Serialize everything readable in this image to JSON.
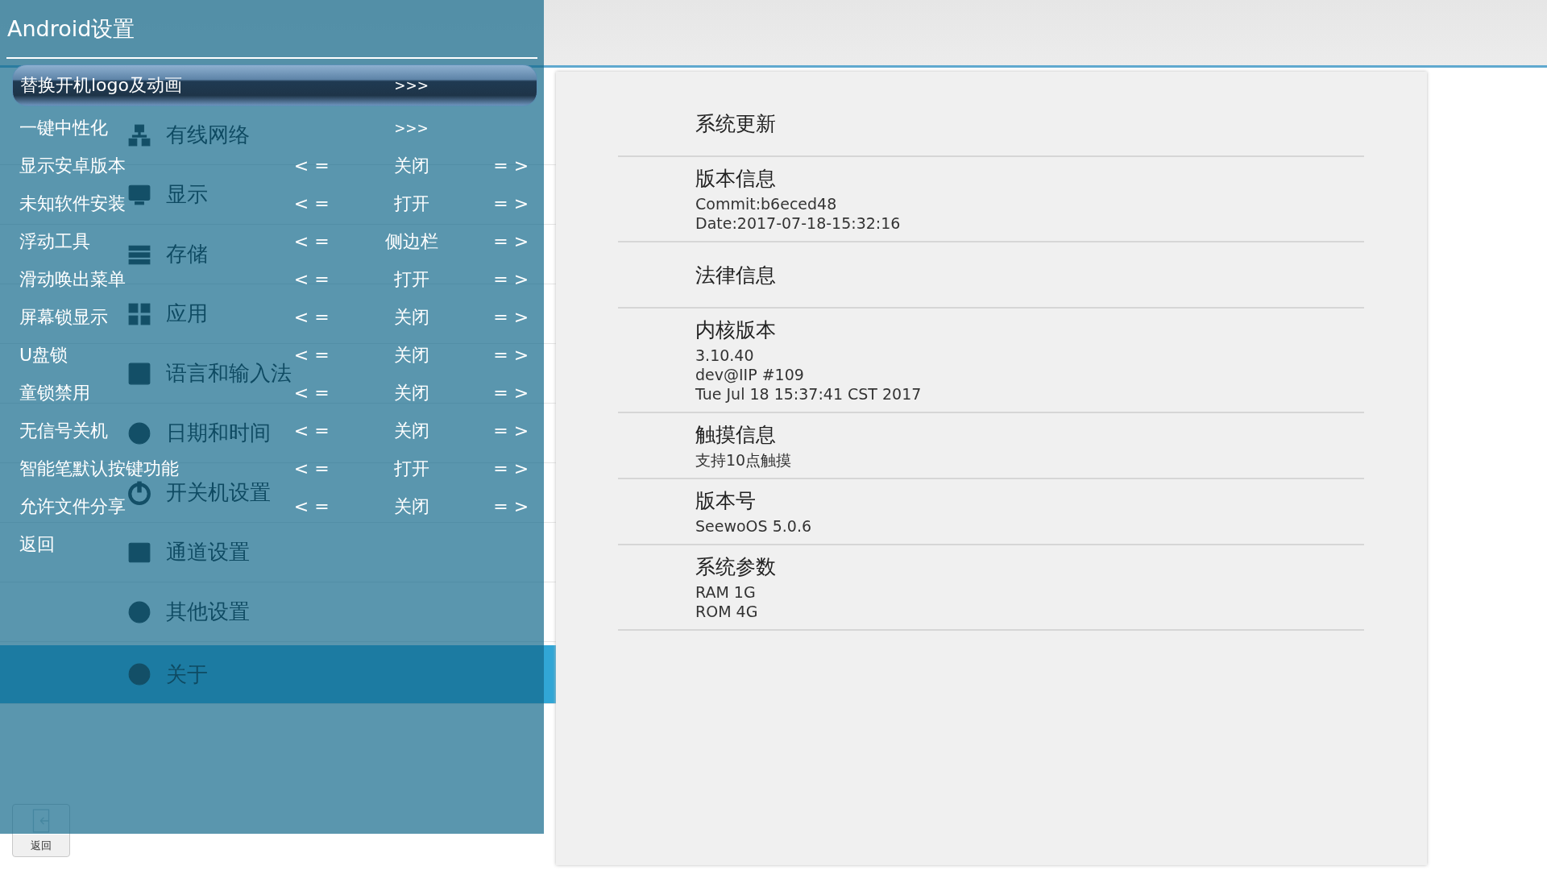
{
  "sidebar": {
    "items": [
      {
        "label": "有线网络",
        "selected": false
      },
      {
        "label": "显示",
        "selected": false
      },
      {
        "label": "存储",
        "selected": false
      },
      {
        "label": "应用",
        "selected": false
      },
      {
        "label": "语言和输入法",
        "selected": false
      },
      {
        "label": "日期和时间",
        "selected": false
      },
      {
        "label": "开关机设置",
        "selected": false
      },
      {
        "label": "通道设置",
        "selected": false
      },
      {
        "label": "其他设置",
        "selected": false
      },
      {
        "label": "关于",
        "selected": true
      }
    ]
  },
  "back_button": {
    "label": "返回"
  },
  "about": {
    "sections": [
      {
        "title": "系统更新"
      },
      {
        "title": "版本信息",
        "lines": [
          "Commit:b6eced48",
          "Date:2017-07-18-15:32:16"
        ]
      },
      {
        "title": "法律信息"
      },
      {
        "title": "内核版本",
        "lines": [
          "3.10.40",
          "dev@IIP #109",
          "Tue Jul 18 15:37:41 CST 2017"
        ]
      },
      {
        "title": "触摸信息",
        "lines": [
          "支持10点触摸"
        ]
      },
      {
        "title": "版本号",
        "lines": [
          "SeewoOS 5.0.6"
        ]
      },
      {
        "title": "系统参数",
        "lines": [
          "RAM  1G",
          "ROM  4G"
        ]
      }
    ]
  },
  "dialog": {
    "title": "Android设置",
    "rows": [
      {
        "kind": "link",
        "label": "替换开机logo及动画",
        "arrow": ">>>",
        "selected": true
      },
      {
        "kind": "link",
        "label": "一键中性化",
        "arrow": ">>>",
        "selected": false
      },
      {
        "kind": "toggle",
        "label": "显示安卓版本",
        "prev": "< =",
        "value": "关闭",
        "next": "= >",
        "selected": false
      },
      {
        "kind": "toggle",
        "label": "未知软件安装",
        "prev": "< =",
        "value": "打开",
        "next": "= >",
        "selected": false
      },
      {
        "kind": "toggle",
        "label": "浮动工具",
        "prev": "< =",
        "value": "侧边栏",
        "next": "= >",
        "selected": false
      },
      {
        "kind": "toggle",
        "label": "滑动唤出菜单",
        "prev": "< =",
        "value": "打开",
        "next": "= >",
        "selected": false
      },
      {
        "kind": "toggle",
        "label": "屏幕锁显示",
        "prev": "< =",
        "value": "关闭",
        "next": "= >",
        "selected": false
      },
      {
        "kind": "toggle",
        "label": "U盘锁",
        "prev": "< =",
        "value": "关闭",
        "next": "= >",
        "selected": false
      },
      {
        "kind": "toggle",
        "label": "童锁禁用",
        "prev": "< =",
        "value": "关闭",
        "next": "= >",
        "selected": false
      },
      {
        "kind": "toggle",
        "label": "无信号关机",
        "prev": "< =",
        "value": "关闭",
        "next": "= >",
        "selected": false
      },
      {
        "kind": "toggle",
        "label": "智能笔默认按键功能",
        "prev": "< =",
        "value": "打开",
        "next": "= >",
        "selected": false
      },
      {
        "kind": "toggle",
        "label": "允许文件分享",
        "prev": "< =",
        "value": "关闭",
        "next": "= >",
        "selected": false
      },
      {
        "kind": "action",
        "label": "返回",
        "selected": false
      }
    ]
  }
}
